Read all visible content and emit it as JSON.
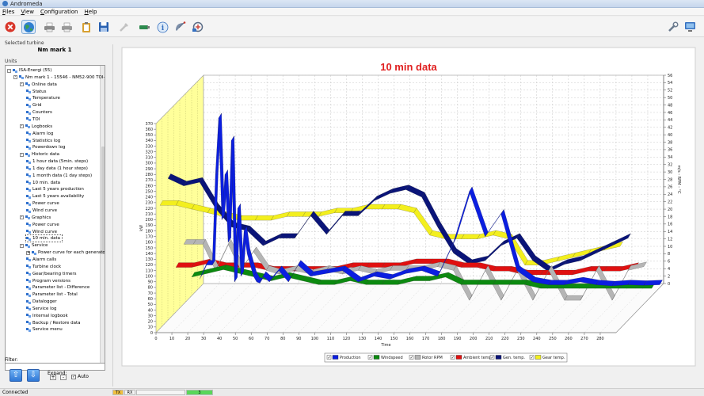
{
  "window": {
    "title": "Andromeda"
  },
  "menu": [
    "Files",
    "View",
    "Configuration",
    "Help"
  ],
  "toolbar": {
    "buttons": [
      {
        "name": "stop-icon",
        "color": "#d8362a"
      },
      {
        "name": "globe-icon",
        "color": "#2d8a4e",
        "selected": true
      },
      {
        "name": "printer-icon",
        "color": "#7a7a7a"
      },
      {
        "name": "printer-preview-icon",
        "color": "#7a7a7a"
      },
      {
        "name": "clipboard-icon",
        "color": "#d8a030"
      },
      {
        "name": "save-icon",
        "color": "#2860b0"
      },
      {
        "name": "tools-icon",
        "color": "#bfbfbf"
      },
      {
        "name": "usb-icon",
        "color": "#2d8a4e"
      },
      {
        "name": "info-icon",
        "color": "#3670c0"
      },
      {
        "name": "dish-icon",
        "color": "#5a6c86"
      },
      {
        "name": "network-icon",
        "color": "#5a6c86"
      }
    ],
    "right_buttons": [
      {
        "name": "wrench-icon",
        "color": "#6a7a8e"
      },
      {
        "name": "monitor-icon",
        "color": "#3670c0"
      }
    ]
  },
  "left_panel": {
    "selected_turbine_label": "Selected turbine",
    "turbine_name": "Nm mark 1",
    "units_label": "Units",
    "tree": [
      {
        "label": "ISA-Energi (55)",
        "level": 0,
        "expander": "-"
      },
      {
        "label": "Nm mark 1 - 15546 - NM52-900 TOI-I",
        "level": 1,
        "expander": "-"
      },
      {
        "label": "Online data",
        "level": 2,
        "expander": "-"
      },
      {
        "label": "Status",
        "level": 3
      },
      {
        "label": "Temperature",
        "level": 3
      },
      {
        "label": "Grid",
        "level": 3
      },
      {
        "label": "Counters",
        "level": 3
      },
      {
        "label": "TOI",
        "level": 3
      },
      {
        "label": "Logbooks",
        "level": 2,
        "expander": "-"
      },
      {
        "label": "Alarm log",
        "level": 3
      },
      {
        "label": "Statistics log",
        "level": 3
      },
      {
        "label": "Powerdown log",
        "level": 3
      },
      {
        "label": "Historic data",
        "level": 2,
        "expander": "-"
      },
      {
        "label": "1 hour data (5min. steps)",
        "level": 3
      },
      {
        "label": "1 day data (1 hour steps)",
        "level": 3
      },
      {
        "label": "1 month data (1 day steps)",
        "level": 3
      },
      {
        "label": "10 min. data",
        "level": 3
      },
      {
        "label": "Last 5 years production",
        "level": 3
      },
      {
        "label": "Last 5 years availability",
        "level": 3
      },
      {
        "label": "Power curve",
        "level": 3
      },
      {
        "label": "Wind curve",
        "level": 3
      },
      {
        "label": "Graphics",
        "level": 2,
        "expander": "-"
      },
      {
        "label": "Power curve",
        "level": 3
      },
      {
        "label": "Wind curve",
        "level": 3
      },
      {
        "label": "10 min. data",
        "level": 3,
        "selected": true
      },
      {
        "label": "Service",
        "level": 2,
        "expander": "-"
      },
      {
        "label": "Power curve for each generator",
        "level": 3,
        "expander": "+"
      },
      {
        "label": "Alarm calls",
        "level": 3
      },
      {
        "label": "Turbine clock",
        "level": 3
      },
      {
        "label": "Gear/bearing timers",
        "level": 3
      },
      {
        "label": "Program versions",
        "level": 3
      },
      {
        "label": "Parameter list - Difference",
        "level": 3
      },
      {
        "label": "Parameter list - Total",
        "level": 3
      },
      {
        "label": "Datalogger",
        "level": 3
      },
      {
        "label": "Service log",
        "level": 3
      },
      {
        "label": "Internal logbook",
        "level": 3
      },
      {
        "label": "Backup / Restore data",
        "level": 3
      },
      {
        "label": "Service menu",
        "level": 3
      }
    ],
    "filter_label": "Filter:",
    "filter_value": "",
    "expand_label": "Expand:",
    "expand_plus": "+",
    "expand_minus": "-",
    "auto_label": "Auto",
    "auto_checked": true,
    "up_arrow": "⇧",
    "down_arrow": "⇩"
  },
  "chart_data": {
    "type": "line",
    "title": "10 min data",
    "xlabel": "Time",
    "ylabel": "kW",
    "y2label": "m/s - RPM - °C",
    "x_ticks": [
      0,
      10,
      20,
      30,
      40,
      50,
      60,
      70,
      80,
      90,
      100,
      110,
      120,
      130,
      140,
      150,
      160,
      170,
      180,
      190,
      200,
      210,
      220,
      230,
      240,
      250,
      260,
      270,
      280
    ],
    "xlim": [
      0,
      290
    ],
    "y_ticks": [
      0,
      10,
      20,
      30,
      40,
      50,
      60,
      70,
      80,
      90,
      100,
      110,
      120,
      130,
      140,
      150,
      160,
      170,
      180,
      190,
      200,
      210,
      220,
      230,
      240,
      250,
      260,
      270,
      280,
      290,
      300,
      310,
      320,
      330,
      340,
      350,
      360,
      370
    ],
    "ylim": [
      0,
      370
    ],
    "y2_ticks": [
      0,
      2,
      4,
      6,
      8,
      10,
      12,
      14,
      16,
      18,
      20,
      22,
      24,
      26,
      28,
      30,
      32,
      34,
      36,
      38,
      40,
      42,
      44,
      46,
      48,
      50,
      52,
      54,
      56
    ],
    "y2lim": [
      0,
      56
    ],
    "grid": true,
    "legend_position": "bottom",
    "series": [
      {
        "name": "Production",
        "color": "#0b1ee0",
        "axis": "left",
        "checked": true,
        "depth": 0,
        "x": [
          0,
          4,
          8,
          10,
          12,
          14,
          16,
          18,
          20,
          22,
          24,
          26,
          28,
          30,
          32,
          34,
          36,
          38,
          40,
          44,
          50,
          56,
          62,
          70,
          80,
          90,
          100,
          110,
          120,
          130,
          140,
          150,
          160,
          170,
          180,
          190,
          200,
          210,
          220,
          230,
          240,
          250,
          260,
          270,
          280,
          290
        ],
        "values": [
          15,
          40,
          40,
          200,
          300,
          120,
          200,
          80,
          260,
          10,
          140,
          20,
          100,
          60,
          40,
          20,
          10,
          8,
          20,
          10,
          30,
          10,
          40,
          20,
          25,
          30,
          10,
          20,
          15,
          25,
          30,
          20,
          80,
          170,
          90,
          130,
          30,
          10,
          5,
          5,
          10,
          5,
          3,
          5,
          4,
          5
        ]
      },
      {
        "name": "Windspeed",
        "color": "#0c8a10",
        "axis": "right",
        "checked": true,
        "depth": 1,
        "x": [
          0,
          10,
          20,
          30,
          40,
          50,
          60,
          70,
          80,
          90,
          100,
          110,
          120,
          130,
          140,
          150,
          160,
          170,
          180,
          190,
          200,
          210,
          220,
          230,
          240,
          250,
          260,
          270,
          280,
          290
        ],
        "values": [
          5,
          6,
          7,
          6,
          5,
          4,
          5,
          4,
          3,
          3,
          4,
          3,
          3,
          3,
          4,
          4,
          5,
          3,
          3,
          3,
          3,
          3,
          2,
          2,
          2,
          2,
          2,
          2,
          2,
          2
        ]
      },
      {
        "name": "Rotor RPM",
        "color": "#b5b5b5",
        "axis": "right",
        "checked": true,
        "depth": 2,
        "x": [
          0,
          6,
          12,
          20,
          28,
          36,
          44,
          52,
          60,
          70,
          80,
          90,
          100,
          110,
          120,
          130,
          140,
          150,
          160,
          170,
          180,
          190,
          200,
          210,
          220,
          230,
          240,
          250,
          260,
          270,
          280,
          290
        ],
        "values": [
          16,
          16,
          16,
          9,
          16,
          9,
          14,
          9,
          8,
          9,
          8,
          9,
          8,
          9,
          8,
          9,
          9,
          9,
          10,
          9,
          1,
          9,
          1,
          9,
          1,
          9,
          1,
          1,
          9,
          1,
          9,
          10
        ]
      },
      {
        "name": "Ambient temp",
        "color": "#e01010",
        "axis": "right",
        "checked": true,
        "depth": 3,
        "x": [
          0,
          10,
          20,
          30,
          40,
          50,
          60,
          70,
          80,
          90,
          100,
          110,
          120,
          130,
          140,
          150,
          160,
          170,
          180,
          190,
          200,
          210,
          220,
          230,
          240,
          250,
          260,
          270,
          280,
          290
        ],
        "values": [
          12,
          12,
          13,
          12,
          12,
          12,
          11,
          11,
          11,
          11,
          11,
          12,
          12,
          12,
          12,
          13,
          13,
          13,
          12,
          12,
          11,
          11,
          10,
          10,
          10,
          10,
          11,
          11,
          11,
          12
        ]
      },
      {
        "name": "Gen. temp.",
        "color": "#0a1478",
        "axis": "right",
        "checked": true,
        "depth": 4,
        "x": [
          0,
          10,
          20,
          30,
          40,
          50,
          60,
          70,
          80,
          90,
          100,
          110,
          120,
          130,
          140,
          150,
          160,
          170,
          180,
          190,
          200,
          210,
          220,
          230,
          240,
          250,
          260,
          270,
          280,
          290
        ],
        "values": [
          38,
          36,
          37,
          30,
          25,
          24,
          20,
          22,
          22,
          28,
          23,
          28,
          28,
          32,
          34,
          35,
          33,
          25,
          18,
          15,
          16,
          20,
          22,
          16,
          13,
          15,
          16,
          18,
          20,
          22
        ]
      },
      {
        "name": "Gear temp.",
        "color": "#f3ef1e",
        "axis": "right",
        "checked": true,
        "depth": 5,
        "x": [
          0,
          10,
          20,
          30,
          40,
          50,
          60,
          70,
          80,
          90,
          100,
          110,
          120,
          130,
          140,
          150,
          160,
          170,
          180,
          190,
          200,
          210,
          220,
          230,
          240,
          250,
          260,
          270,
          280,
          290
        ],
        "values": [
          33,
          33,
          32,
          31,
          30,
          29,
          29,
          29,
          30,
          30,
          30,
          31,
          31,
          32,
          32,
          32,
          31,
          25,
          24,
          24,
          24,
          25,
          24,
          17,
          17,
          18,
          19,
          20,
          21,
          22
        ]
      }
    ]
  },
  "statusbar": {
    "connected": "Connected",
    "tx": "TX",
    "rx": "RX",
    "progress_value": "3",
    "tx_color": "#f0c040",
    "progress_color": "#5ad65a"
  }
}
